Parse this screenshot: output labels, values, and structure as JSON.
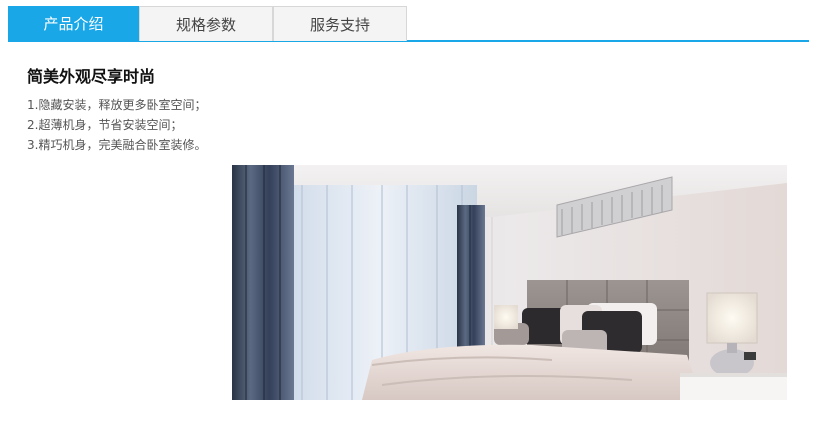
{
  "tabs": [
    {
      "label": "产品介绍",
      "active": true
    },
    {
      "label": "规格参数",
      "active": false
    },
    {
      "label": "服务支持",
      "active": false
    }
  ],
  "content": {
    "heading": "简美外观尽享时尚",
    "features": [
      "1.隐藏安装，释放更多卧室空间；",
      "2.超薄机身，节省安装空间；",
      "3.精巧机身，完美融合卧室装修。"
    ]
  },
  "colors": {
    "accent": "#1aa7e8"
  }
}
